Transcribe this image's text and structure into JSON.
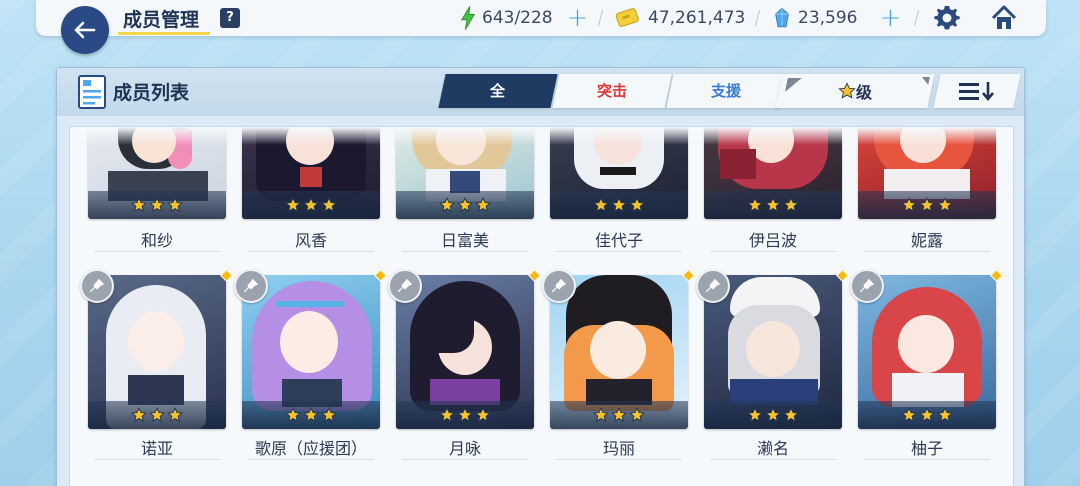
{
  "header": {
    "title": "成员管理",
    "help_label": "?",
    "ap": "643/228",
    "credits": "47,261,473",
    "pyroxene": "23,596",
    "plus_glyph": "+"
  },
  "panel": {
    "title": "成员列表",
    "tabs": [
      {
        "label": "全"
      },
      {
        "label": "突击"
      },
      {
        "label": "支援"
      }
    ],
    "filter_label": "级"
  },
  "students_row1": [
    {
      "name": "和纱"
    },
    {
      "name": "风香"
    },
    {
      "name": "日富美"
    },
    {
      "name": "佳代子"
    },
    {
      "name": "伊吕波"
    },
    {
      "name": "妮露"
    }
  ],
  "students_row2": [
    {
      "name": "诺亚"
    },
    {
      "name": "歌原（应援团）"
    },
    {
      "name": "月咏"
    },
    {
      "name": "玛丽"
    },
    {
      "name": "濑名"
    },
    {
      "name": "柚子"
    }
  ],
  "stars_per_student": 3,
  "colors": {
    "navy": "#1f3b62",
    "striker": "#d63a3a",
    "special": "#3b7cd2",
    "star": "#f6c22b",
    "ap": "#43c047",
    "pyroxene": "#4fa6f0"
  }
}
